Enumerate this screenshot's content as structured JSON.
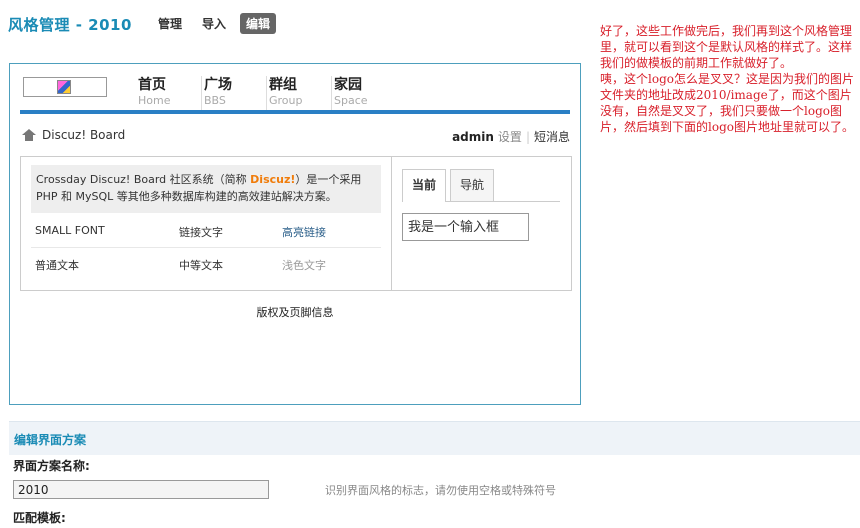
{
  "header": {
    "title": "风格管理 - 2010",
    "tabs": [
      {
        "label": "管理"
      },
      {
        "label": "导入"
      },
      {
        "label": "编辑"
      }
    ]
  },
  "preview": {
    "nav": [
      {
        "zh": "首页",
        "en": "Home"
      },
      {
        "zh": "广场",
        "en": "BBS"
      },
      {
        "zh": "群组",
        "en": "Group"
      },
      {
        "zh": "家园",
        "en": "Space"
      }
    ],
    "breadcrumb": "Discuz! Board",
    "user": {
      "name": "admin",
      "settings": "设置",
      "sep": "|",
      "messages": "短消息"
    },
    "intro": {
      "before": "Crossday Discuz! Board 社区系统（简称 ",
      "brand": "Discuz!",
      "after": "）是一个采用 PHP 和 MySQL 等其他多种数据库构建的高效建站解决方案。"
    },
    "rows": [
      [
        "SMALL FONT",
        "链接文字",
        "高亮链接"
      ],
      [
        "普通文本",
        "中等文本",
        "浅色文字"
      ]
    ],
    "side_tabs": [
      {
        "label": "当前"
      },
      {
        "label": "导航"
      }
    ],
    "input_value": "我是一个输入框",
    "footer": "版权及页脚信息"
  },
  "note": "好了，这些工作做完后，我们再到这个风格管理里，就可以看到这个是默认风格的样式了。这样我们的做模板的前期工作就做好了。\n咦，这个logo怎么是叉叉？这是因为我们的图片文件夹的地址改成2010/image了，而这个图片没有，自然是叉叉了，我们只要做一个logo图片，然后填到下面的logo图片地址里就可以了。",
  "edit": {
    "section_title": "编辑界面方案",
    "name_label": "界面方案名称:",
    "name_value": "2010",
    "name_hint": "识别界面风格的标志，请勿使用空格或特殊符号",
    "template_label": "匹配模板:"
  }
}
